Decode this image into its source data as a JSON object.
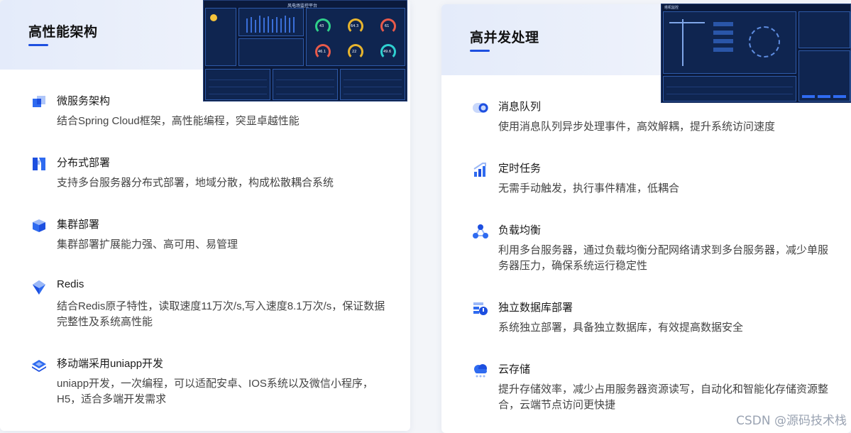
{
  "left": {
    "title": "高性能架构",
    "features": [
      {
        "title": "微服务架构",
        "desc": "结合Spring Cloud框架，高性能编程，突显卓越性能",
        "icon": "microservice-icon"
      },
      {
        "title": "分布式部署",
        "desc": "支持多台服务器分布式部署，地域分散，构成松散耦合系统",
        "icon": "distributed-icon"
      },
      {
        "title": "集群部署",
        "desc": "集群部署扩展能力强、高可用、易管理",
        "icon": "cluster-icon"
      },
      {
        "title": "Redis",
        "desc": "结合Redis原子特性，读取速度11万次/s,写入速度8.1万次/s，保证数据完整性及系统高性能",
        "icon": "redis-icon"
      },
      {
        "title": "移动端采用uniapp开发",
        "desc": "uniapp开发，一次编程，可以适配安卓、IOS系统以及微信小程序，H5，适合多端开发需求",
        "icon": "mobile-icon"
      }
    ],
    "screenshot": {
      "title": "风电场监控平台",
      "gauges": [
        "43",
        "64.3",
        "61",
        "46.1",
        "22",
        "49.6"
      ]
    }
  },
  "right": {
    "title": "高并发处理",
    "features": [
      {
        "title": "消息队列",
        "desc": "使用消息队列异步处理事件，高效解耦，提升系统访问速度",
        "icon": "message-queue-icon"
      },
      {
        "title": "定时任务",
        "desc": "无需手动触发，执行事件精准，低耦合",
        "icon": "scheduled-task-icon"
      },
      {
        "title": "负载均衡",
        "desc": "利用多台服务器，通过负载均衡分配网络请求到多台服务器，减少单服务器压力，确保系统运行稳定性",
        "icon": "load-balance-icon"
      },
      {
        "title": "独立数据库部署",
        "desc": "系统独立部署，具备独立数据库，有效提高数据安全",
        "icon": "database-icon"
      },
      {
        "title": "云存储",
        "desc": "提升存储效率，减少占用服务器资源读写，自动化和智能化存储资源整合，云端节点访问更快捷",
        "icon": "cloud-storage-icon"
      }
    ],
    "screenshot": {
      "title": "塔机监控"
    }
  },
  "watermark": "CSDN @源码技术栈",
  "colors": {
    "accent": "#1d4fe0",
    "icon_blue": "#2f6bf0",
    "dashboard_bg": "#0b1a3c"
  }
}
